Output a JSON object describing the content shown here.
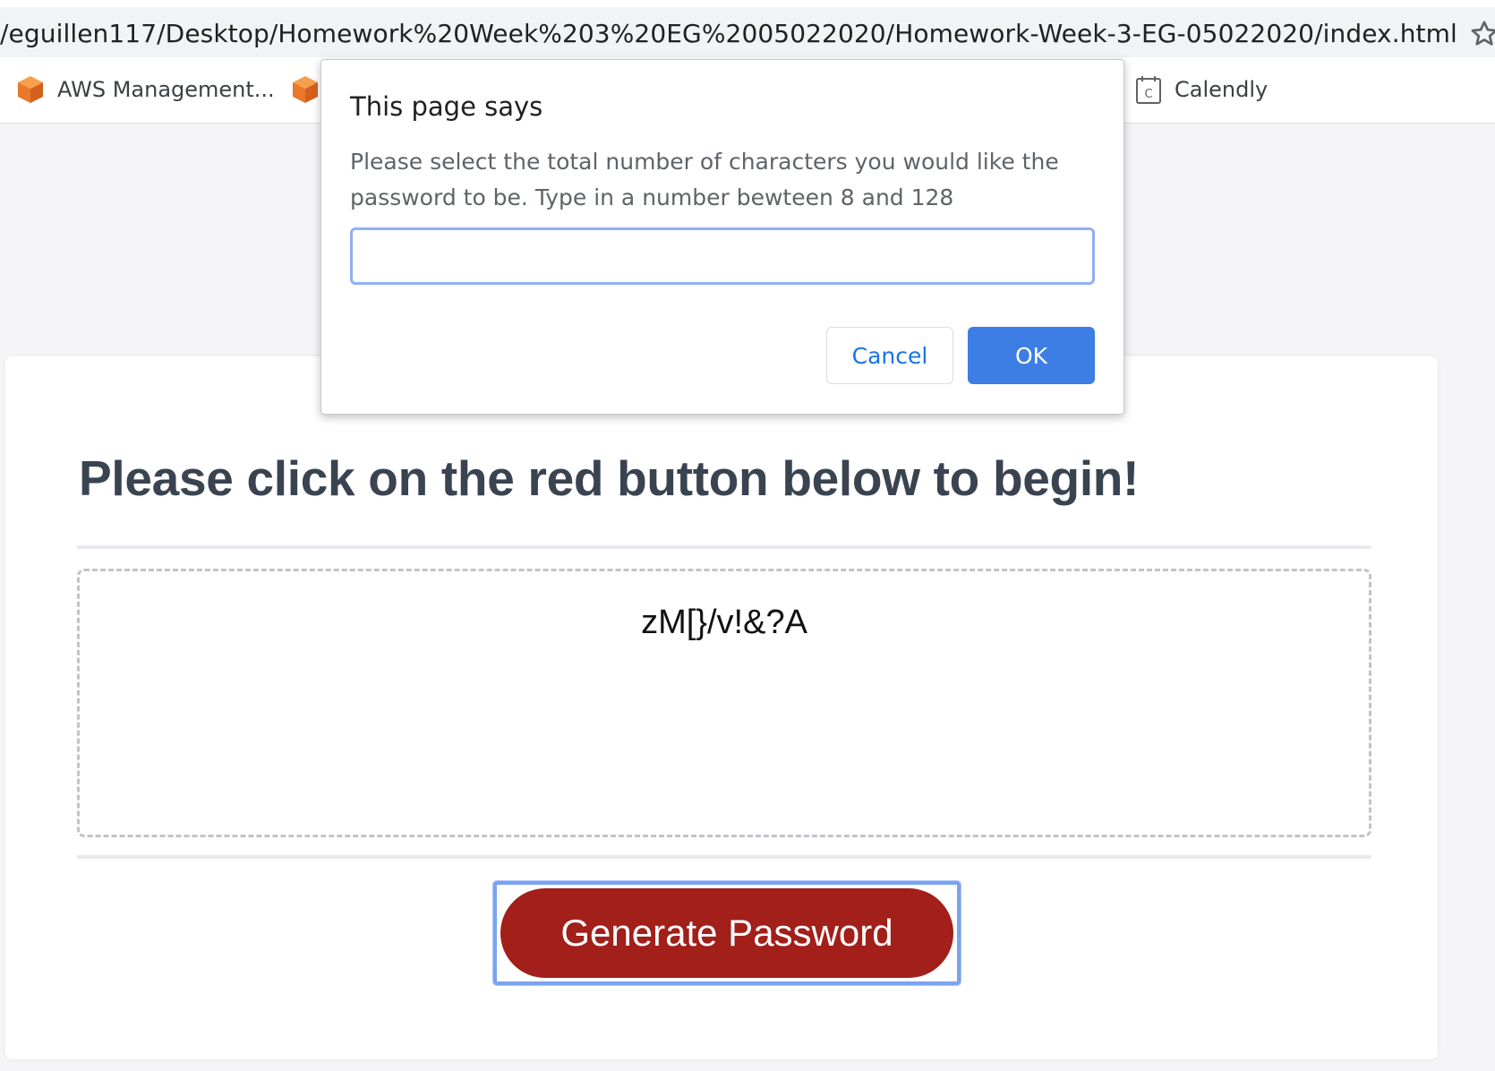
{
  "browser": {
    "url": "/eguillen117/Desktop/Homework%20Week%203%20EG%2005022020/Homework-Week-3-EG-05022020/index.html",
    "bookmarks": [
      {
        "label": "AWS Management...",
        "icon": "aws-cube-icon"
      },
      {
        "label": "",
        "icon": "aws-cube-icon"
      },
      {
        "label": "Calendly",
        "icon": "calendar-icon"
      }
    ]
  },
  "dialog": {
    "title": "This page says",
    "message": "Please select the total number of characters you would like the password to be. Type in a number bewteen 8 and 128",
    "input_value": "",
    "cancel_label": "Cancel",
    "ok_label": "OK"
  },
  "card": {
    "title": "Please click on the red button below to begin!",
    "password": "zM[}/v!&?A",
    "generate_label": "Generate Password"
  },
  "colors": {
    "generate_button": "#a21f1a",
    "ok_button": "#3c7ee3",
    "link_blue": "#1a73e8",
    "title_text": "#3a4350"
  }
}
